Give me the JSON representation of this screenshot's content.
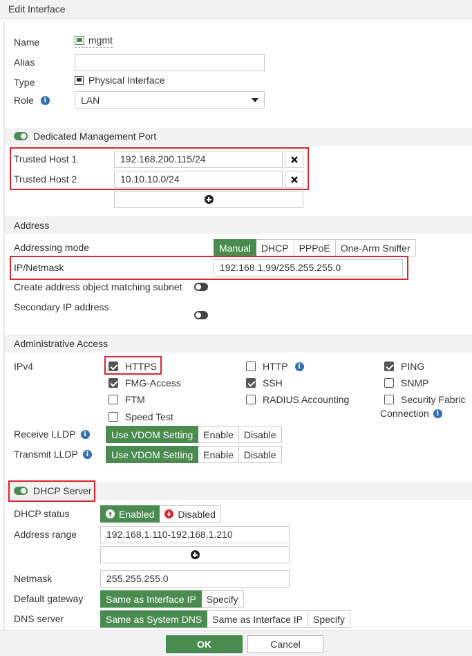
{
  "window": {
    "title": "Edit Interface"
  },
  "general": {
    "name_label": "Name",
    "name_value": "mgmt",
    "alias_label": "Alias",
    "alias_value": "",
    "type_label": "Type",
    "type_value": "Physical Interface",
    "role_label": "Role",
    "role_value": "LAN"
  },
  "mgmt_port": {
    "title": "Dedicated Management Port",
    "enabled": true,
    "trusted_hosts": [
      {
        "label": "Trusted Host 1",
        "value": "192.168.200.115/24"
      },
      {
        "label": "Trusted Host 2",
        "value": "10.10.10.0/24"
      }
    ]
  },
  "address": {
    "title": "Address",
    "mode_label": "Addressing mode",
    "modes": [
      "Manual",
      "DHCP",
      "PPPoE",
      "One-Arm Sniffer"
    ],
    "active_mode": "Manual",
    "ip_label": "IP/Netmask",
    "ip_value": "192.168.1.99/255.255.255.0",
    "create_obj_label": "Create address object matching subnet",
    "secondary_label": "Secondary IP address"
  },
  "admin_access": {
    "title": "Administrative Access",
    "ipv4_label": "IPv4",
    "options": [
      {
        "label": "HTTPS",
        "checked": true
      },
      {
        "label": "HTTP",
        "checked": false
      },
      {
        "label": "PING",
        "checked": true
      },
      {
        "label": "FMG-Access",
        "checked": true
      },
      {
        "label": "SSH",
        "checked": true
      },
      {
        "label": "SNMP",
        "checked": false
      },
      {
        "label": "FTM",
        "checked": false
      },
      {
        "label": "RADIUS Accounting",
        "checked": false
      },
      {
        "label": "Security Fabric",
        "label2": "Connection",
        "checked": false
      },
      {
        "label": "Speed Test",
        "checked": false
      }
    ],
    "receive_lldp_label": "Receive LLDP",
    "transmit_lldp_label": "Transmit LLDP",
    "lldp_options": [
      "Use VDOM Setting",
      "Enable",
      "Disable"
    ]
  },
  "dhcp": {
    "title": "DHCP Server",
    "enabled": true,
    "status_label": "DHCP status",
    "status_enabled": "Enabled",
    "status_disabled": "Disabled",
    "range_label": "Address range",
    "range_value": "192.168.1.110-192.168.1.210",
    "netmask_label": "Netmask",
    "netmask_value": "255.255.255.0",
    "gateway_label": "Default gateway",
    "gateway_options": [
      "Same as Interface IP",
      "Specify"
    ],
    "dns_label": "DNS server",
    "dns_options": [
      "Same as System DNS",
      "Same as Interface IP",
      "Specify"
    ]
  },
  "footer": {
    "ok": "OK",
    "cancel": "Cancel"
  },
  "colors": {
    "accent_green": "#4a8c4f",
    "highlight_red": "#d9262c",
    "info_blue": "#2f6fb0"
  }
}
